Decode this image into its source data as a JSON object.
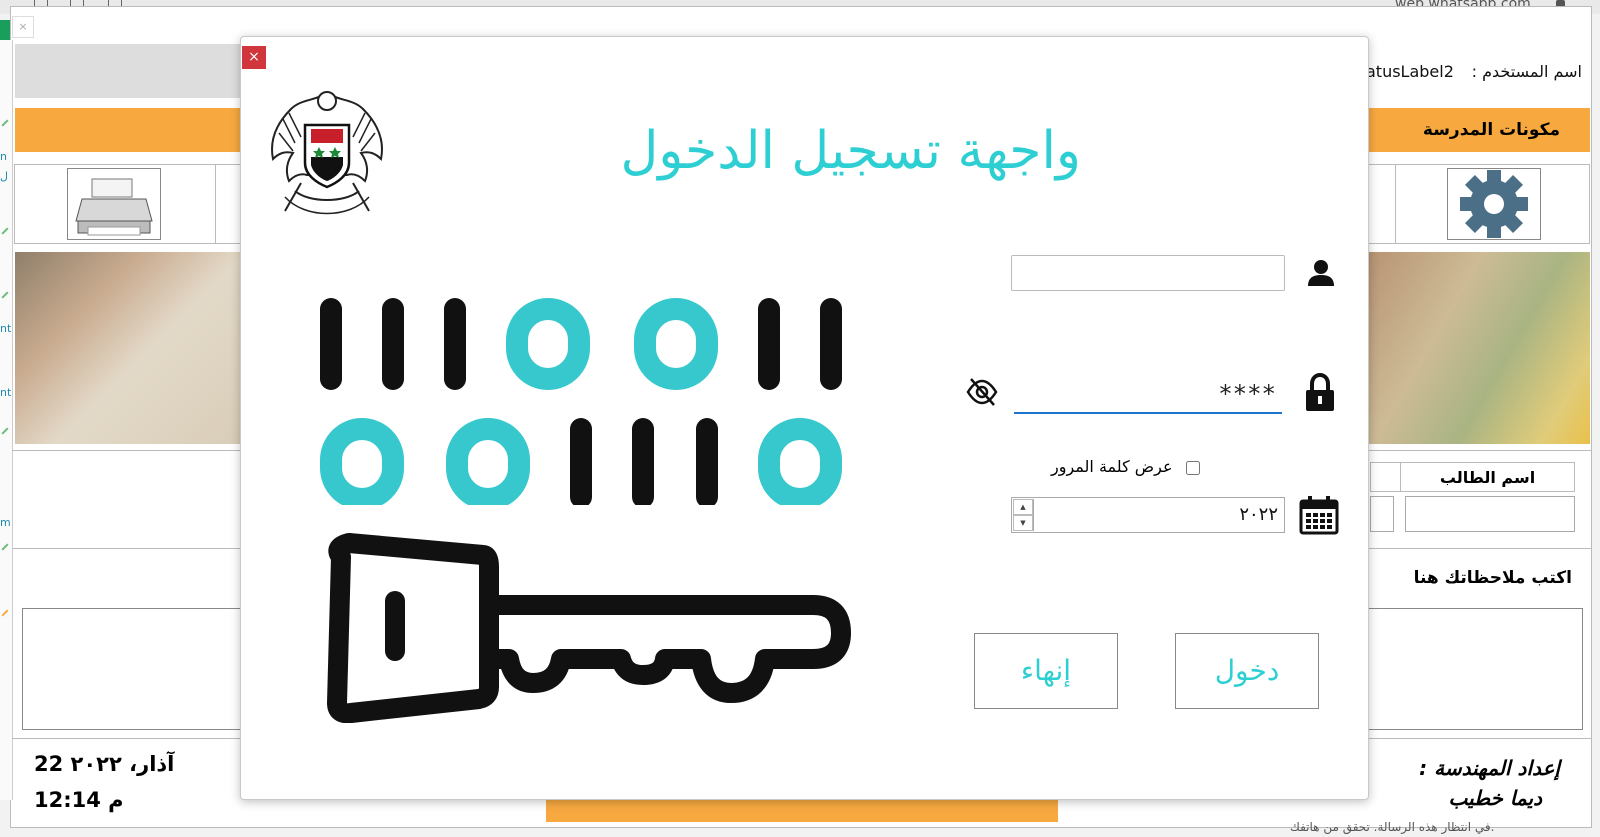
{
  "browser": {
    "url": "web.whatsapp.com"
  },
  "app": {
    "close_glyph": "×",
    "username_label": "اسم المستخدم :",
    "username_value": "atusLabel2",
    "school_components": "مكونات المدرسة",
    "student_name_label": "اسم الطالب",
    "notes_label": "اكتب ملاحظاتك هنا",
    "date_text": "آذار، ٢٠٢٢ 22",
    "time_text": "12:14 م",
    "credit_line1": "إعداد المهندسة :",
    "credit_line2": "ديما خطيب",
    "strip_chars": [
      "n",
      "ل",
      "nt",
      "nt",
      "m"
    ],
    "whatsapp_note": "في انتظار هذه الرسالة. تحقق من هاتفك."
  },
  "dialog": {
    "close_glyph": "×",
    "title": "واجهة تسجيل الدخول",
    "username_value": "",
    "password_value": "****",
    "show_password_label": "عرض كلمة المرور",
    "show_password_checked": false,
    "year_value": "٢٠٢٢",
    "login_button": "دخول",
    "exit_button": "إنهاء",
    "accent_color": "#2ecfd3",
    "binary_rows": [
      "IIIOOII",
      "OOIIIO"
    ],
    "icons": [
      "emblem-icon",
      "user-icon",
      "lock-icon",
      "eye-slash-icon",
      "calendar-icon",
      "key-icon",
      "printer-icon",
      "gear-icon"
    ]
  }
}
